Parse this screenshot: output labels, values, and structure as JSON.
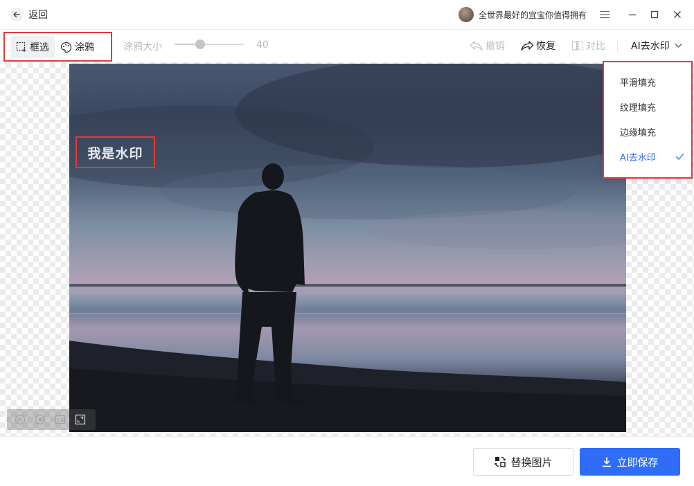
{
  "header": {
    "back_label": "返回",
    "username": "全世界最好的宜宝你值得拥有"
  },
  "toolbar": {
    "select_label": "框选",
    "brush_label": "涂鸦",
    "brush_size_label": "涂鸦大小",
    "brush_size_value": "40",
    "brush_size_fraction": 0.37,
    "undo_label": "撤销",
    "redo_label": "恢复",
    "compare_label": "对比",
    "mode_label": "AI去水印"
  },
  "canvas": {
    "watermark_text": "我是水印"
  },
  "dropdown": {
    "items": [
      {
        "label": "平滑填充"
      },
      {
        "label": "纹理填充"
      },
      {
        "label": "边缘填充"
      },
      {
        "label": "AI去水印"
      }
    ],
    "selected_index": 3
  },
  "footer": {
    "replace_label": "替换图片",
    "save_label": "立即保存"
  },
  "colors": {
    "accent": "#2f6df6",
    "highlight": "#e53935"
  }
}
